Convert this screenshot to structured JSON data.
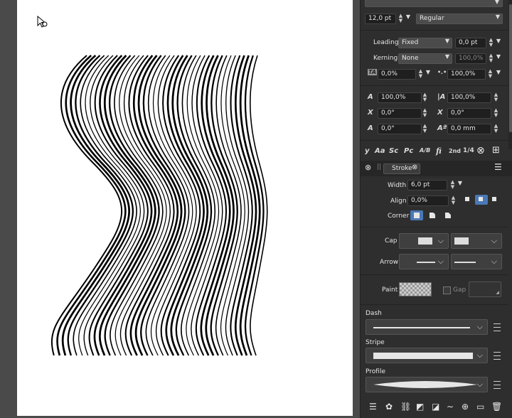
{
  "character": {
    "font_size": "12,0 pt",
    "font_style": "Regular",
    "leading_label": "Leading",
    "leading_mode": "Fixed",
    "leading_value": "0,0 pt",
    "kerning_label": "Kerning",
    "kerning_mode": "None",
    "kerning_value": "100,0%",
    "tracking_value": "0,0%",
    "spacing_value": "100,0%",
    "scale_h": "100,0%",
    "scale_v": "100,0%",
    "skew_1": "0,0°",
    "skew_2": "0,0°",
    "rotate": "0,0°",
    "baseline": "0,0 mm",
    "typography_buttons": [
      "y",
      "Aa",
      "Sc",
      "Pc",
      "A/B",
      "fi",
      "2nd",
      "1/4"
    ]
  },
  "stroke": {
    "tab_label": "Stroke",
    "width_label": "Width",
    "width_value": "6,0 pt",
    "align_label": "Align",
    "align_value": "0,0%",
    "corner_label": "Corner",
    "cap_label": "Cap",
    "arrow_label": "Arrow",
    "paint_label": "Paint",
    "gap_label": "Gap",
    "dash_label": "Dash",
    "stripe_label": "Stripe",
    "profile_label": "Profile"
  }
}
